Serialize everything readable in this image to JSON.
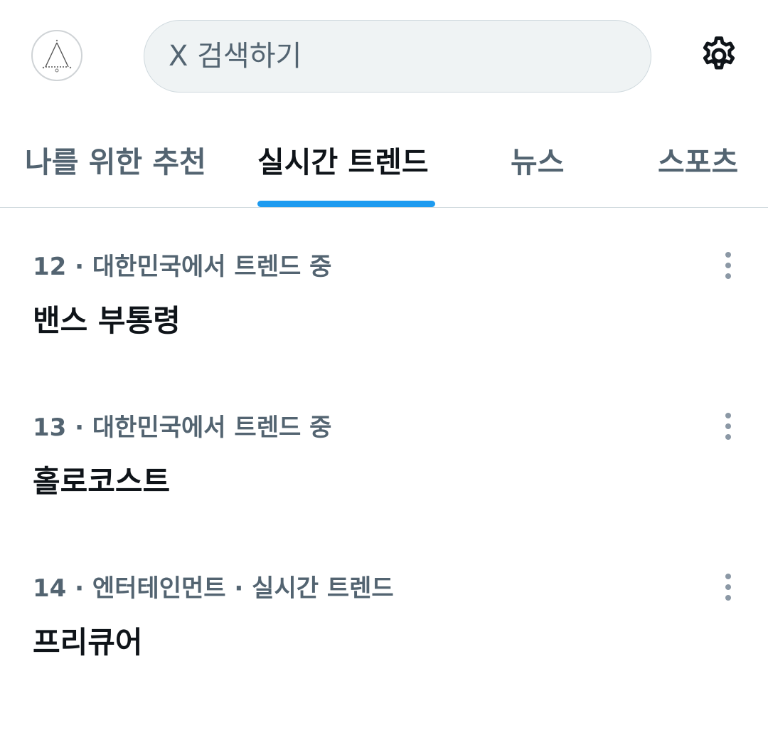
{
  "header": {
    "search_placeholder": "X 검색하기",
    "avatar_icon": "triangle-logo-icon",
    "settings_icon": "gear-icon"
  },
  "tabs": [
    {
      "label": "나를 위한 추천",
      "active": false
    },
    {
      "label": "실시간 트렌드",
      "active": true
    },
    {
      "label": "뉴스",
      "active": false
    },
    {
      "label": "스포츠",
      "active": false
    }
  ],
  "trends": [
    {
      "meta": "12 · 대한민국에서 트렌드 중",
      "title": "밴스 부통령"
    },
    {
      "meta": "13 · 대한민국에서 트렌드 중",
      "title": "홀로코스트"
    },
    {
      "meta": "14 · 엔터테인먼트 · 실시간 트렌드",
      "title": "프리큐어"
    }
  ],
  "colors": {
    "accent": "#1d9bf0",
    "primary_text": "#0f1419",
    "secondary_text": "#536471",
    "search_bg": "#eff3f4"
  }
}
